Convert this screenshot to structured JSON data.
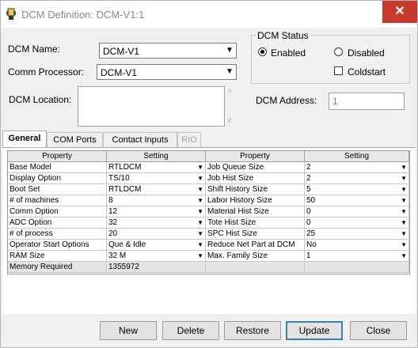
{
  "window": {
    "title": "DCM Definition:  DCM-V1:1",
    "close_glyph": "✕"
  },
  "form": {
    "dcm_name_label": "DCM Name:",
    "dcm_name_value": "DCM-V1",
    "comm_processor_label": "Comm Processor:",
    "comm_processor_value": "DCM-V1",
    "dcm_location_label": "DCM Location:",
    "dcm_location_value": "",
    "dcm_address_label": "DCM Address:",
    "dcm_address_value": "1"
  },
  "status": {
    "title": "DCM Status",
    "enabled_label": "Enabled",
    "disabled_label": "Disabled",
    "coldstart_label": "Coldstart",
    "selected": "Enabled",
    "coldstart_checked": false
  },
  "tabs": [
    {
      "label": "General",
      "active": true,
      "disabled": false
    },
    {
      "label": "COM Ports",
      "active": false,
      "disabled": false
    },
    {
      "label": "Contact Inputs",
      "active": false,
      "disabled": false
    },
    {
      "label": "RIO",
      "active": false,
      "disabled": true
    }
  ],
  "grid_left": {
    "headers": [
      "Property",
      "Setting"
    ],
    "rows": [
      {
        "property": "Base Model",
        "setting": "RTLDCM",
        "dropdown": true
      },
      {
        "property": "Display Option",
        "setting": "TS/10",
        "dropdown": true
      },
      {
        "property": "Boot Set",
        "setting": "RTLDCM",
        "dropdown": true
      },
      {
        "property": "# of machines",
        "setting": "8",
        "dropdown": true
      },
      {
        "property": "Comm Option",
        "setting": "12",
        "dropdown": true
      },
      {
        "property": "ADC Option",
        "setting": "32",
        "dropdown": true
      },
      {
        "property": "# of process",
        "setting": "20",
        "dropdown": true
      },
      {
        "property": "Operator Start Options",
        "setting": "Que & Idle",
        "dropdown": true
      },
      {
        "property": "RAM Size",
        "setting": "32 M",
        "dropdown": true
      },
      {
        "property": "Memory Required",
        "setting": "1355972",
        "dropdown": false,
        "readonly": true
      }
    ]
  },
  "grid_right": {
    "headers": [
      "Property",
      "Setting"
    ],
    "rows": [
      {
        "property": "Job Queue Size",
        "setting": "2",
        "dropdown": true
      },
      {
        "property": "Job Hist Size",
        "setting": "2",
        "dropdown": true
      },
      {
        "property": "Shift History Size",
        "setting": "5",
        "dropdown": true
      },
      {
        "property": "Labor History Size",
        "setting": "50",
        "dropdown": true
      },
      {
        "property": "Material Hist Size",
        "setting": "0",
        "dropdown": true
      },
      {
        "property": "Tote Hist Size",
        "setting": "0",
        "dropdown": true
      },
      {
        "property": "SPC Hist Size",
        "setting": "25",
        "dropdown": true
      },
      {
        "property": "Reduce Net Part at DCM",
        "setting": "No",
        "dropdown": true
      },
      {
        "property": "Max. Family Size",
        "setting": "1",
        "dropdown": true
      }
    ]
  },
  "buttons": {
    "new": "New",
    "delete": "Delete",
    "restore": "Restore",
    "update": "Update",
    "close": "Close"
  },
  "colors": {
    "close_red": "#c6392b",
    "focus_blue": "#3c7fb1"
  }
}
